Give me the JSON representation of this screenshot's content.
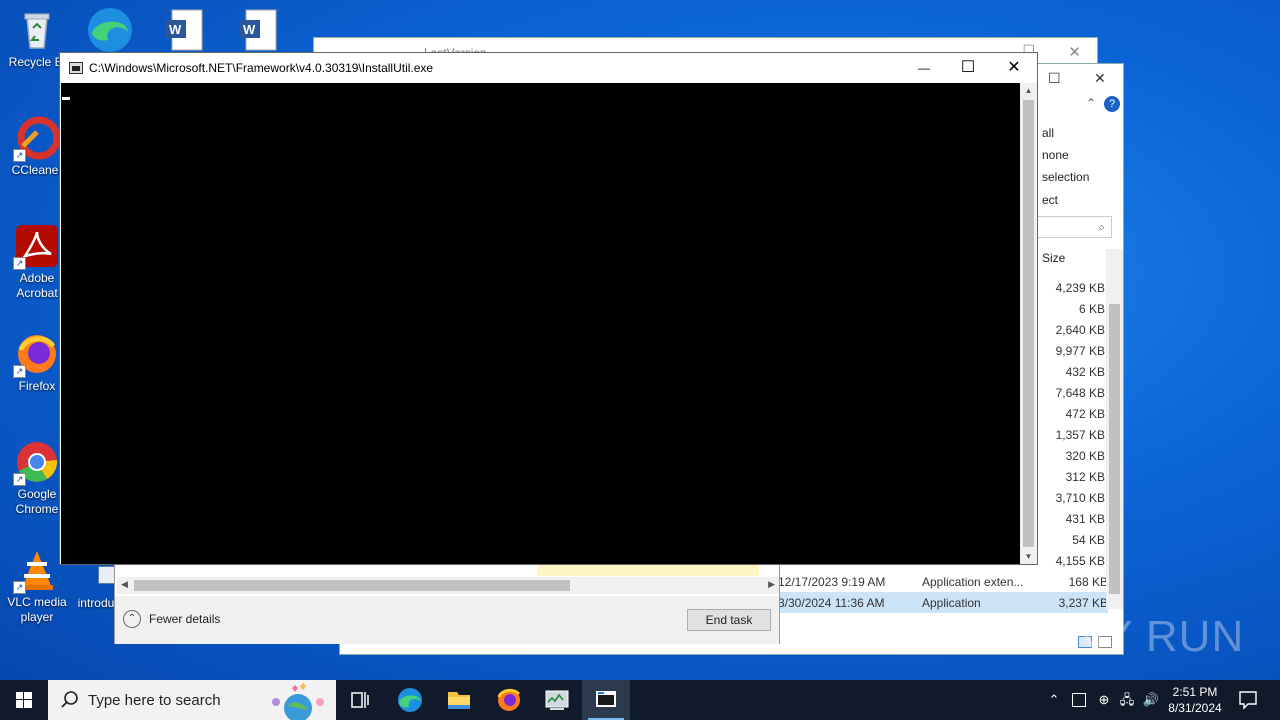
{
  "desktop": {
    "icons": [
      {
        "label": "Recycle Bi",
        "icon": "recycle-bin-icon"
      },
      {
        "label": "CCleaner",
        "icon": "ccleaner-icon"
      },
      {
        "label": "Adobe Acrobat",
        "icon": "adobe-acrobat-icon"
      },
      {
        "label": "Firefox",
        "icon": "firefox-icon"
      },
      {
        "label": "Google Chrome",
        "icon": "chrome-icon"
      },
      {
        "label": "VLC media player",
        "icon": "vlc-icon"
      },
      {
        "label": "introdu",
        "icon": "document-icon"
      }
    ]
  },
  "explorer_back": {
    "title": "LastVersion"
  },
  "explorer": {
    "ribbon": [
      "all",
      "none",
      "selection",
      "ect"
    ],
    "size_header": "Size",
    "sizes": [
      "4,239 KB",
      "6 KB",
      "2,640 KB",
      "9,977 KB",
      "432 KB",
      "7,648 KB",
      "472 KB",
      "1,357 KB",
      "320 KB",
      "312 KB",
      "3,710 KB",
      "431 KB",
      "54 KB",
      "4,155 KB"
    ],
    "rows": [
      {
        "date": "12/17/2023 9:19 AM",
        "type": "Application exten...",
        "size": "168 KB"
      },
      {
        "date": "3/30/2024 11:36 AM",
        "type": "Application",
        "size": "3,237 KB"
      }
    ]
  },
  "taskmgr": {
    "fewer_details": "Fewer details",
    "end_task": "End task"
  },
  "console": {
    "title": "C:\\Windows\\Microsoft.NET\\Framework\\v4.0.30319\\InstallUtil.exe",
    "minimize": "—",
    "maximize": "☐",
    "close": "✕"
  },
  "watermark": "ANY RUN",
  "taskbar": {
    "search_placeholder": "Type here to search",
    "time": "2:51 PM",
    "date": "8/31/2024"
  }
}
